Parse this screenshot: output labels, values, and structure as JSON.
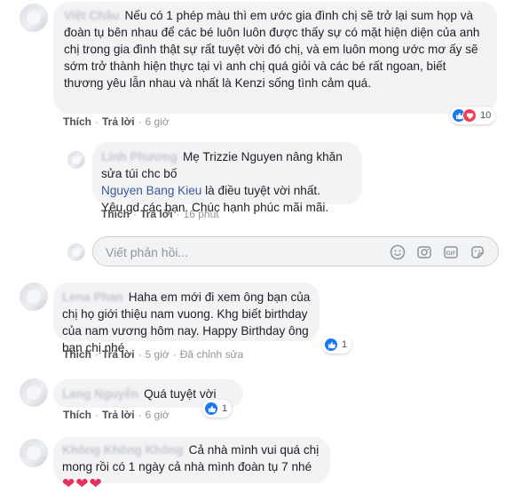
{
  "comments": [
    {
      "author": "Việt Châu",
      "text": "Nếu có 1 phép màu thì em ước gia đình chị sẽ trở lại sum họp và đoàn tụ bên nhau để các bé luôn luôn được thấy sự có mặt hiện diện của anh chị trong gia đình thật sự rất tuyệt vời đó chị, và em luôn mong ước mơ ấy sẽ sớm trở thành hiện thực tại vì anh chị quá giỏi và các bé rất ngoan, biết thương yêu lẫn nhau và nhất là Kenzi sống tình cảm quá.",
      "like_label": "Thích",
      "reply_label": "Trả lời",
      "time": "6 giờ",
      "reaction_count": "10",
      "reaction_icons": [
        "like-icon",
        "love-icon"
      ]
    },
    {
      "author": "Linh Phương",
      "text_before": "Mẹ Trizzie Nguyen nâng khăn sửa túi chc bố",
      "mention": "Nguyen Bang Kieu",
      "text_after": "là điều tuyệt vời nhất.",
      "text_line3": "Yêu gd các bạn. Chúc hạnh phúc mãi mãi.",
      "like_label": "Thích",
      "reply_label": "Trả lời",
      "time": "16 phút"
    },
    {
      "author": "Lena Phan",
      "text": "Haha em mới đi xem ông bạn của chị họ giới thiệu nam vuong. Khg biết birthday của nam vương hôm nay. Happy Birthday ông bạn chị nhé",
      "like_label": "Thích",
      "reply_label": "Trả lời",
      "time": "5 giờ",
      "edited_label": "Đã chỉnh sửa",
      "reaction_count": "1",
      "reaction_icons": [
        "like-icon"
      ]
    },
    {
      "author": "Lang Nguyễn",
      "text": "Quá tuyệt vời",
      "like_label": "Thích",
      "reply_label": "Trả lời",
      "time": "6 giờ",
      "reaction_count": "1",
      "reaction_icons": [
        "like-icon"
      ]
    },
    {
      "author": "Không Không Không",
      "text": "Cả nhà mình vui quá chị mong rồi có 1 ngày cả nhà mình đoàn tụ 7 nhé",
      "hearts": "❤❤❤"
    }
  ],
  "reply_box": {
    "placeholder": "Viết phản hồi...",
    "tools": [
      "emoji-icon",
      "camera-icon",
      "gif-icon",
      "sticker-icon"
    ]
  },
  "colors": {
    "bubble": "#f2f3f5",
    "link": "#385898",
    "like_blue": "#1877f2",
    "love_red": "#f33e58"
  }
}
